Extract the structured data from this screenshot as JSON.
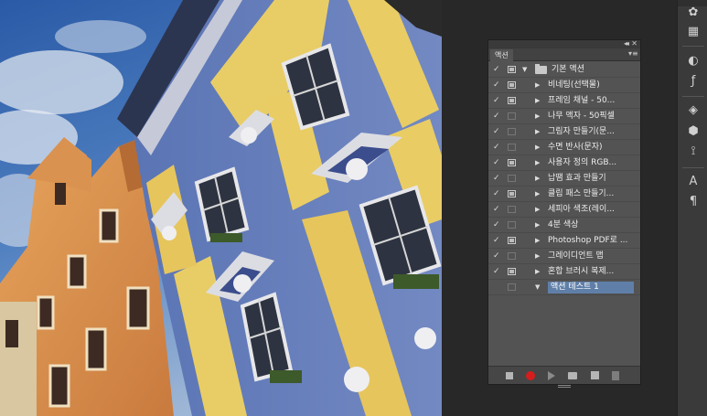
{
  "panel": {
    "tab_label": "액션",
    "collapse_glyph": "◂◂",
    "close_glyph": "✕",
    "menu_glyph": "▾≡",
    "rows": [
      {
        "label": "기본 액션",
        "checked": true,
        "dialog": "filled",
        "type": "set",
        "expanded": true
      },
      {
        "label": "비네팅(선택물)",
        "checked": true,
        "dialog": "filled",
        "type": "action"
      },
      {
        "label": "프레임 채널 - 50...",
        "checked": true,
        "dialog": "filled",
        "type": "action"
      },
      {
        "label": "나무 액자 - 50픽셀",
        "checked": true,
        "dialog": "empty",
        "type": "action"
      },
      {
        "label": "그림자 만들기(문...",
        "checked": true,
        "dialog": "empty",
        "type": "action"
      },
      {
        "label": "수면 반사(문자)",
        "checked": true,
        "dialog": "empty",
        "type": "action"
      },
      {
        "label": "사용자 정의 RGB...",
        "checked": true,
        "dialog": "filled",
        "type": "action"
      },
      {
        "label": "납땜 효과 만들기",
        "checked": true,
        "dialog": "empty",
        "type": "action"
      },
      {
        "label": "클립 패스 만들기...",
        "checked": true,
        "dialog": "filled",
        "type": "action"
      },
      {
        "label": "세피아 색조(레이...",
        "checked": true,
        "dialog": "empty",
        "type": "action"
      },
      {
        "label": "4분 색상",
        "checked": true,
        "dialog": "empty",
        "type": "action"
      },
      {
        "label": "Photoshop PDF로 ...",
        "checked": true,
        "dialog": "filled",
        "type": "action"
      },
      {
        "label": "그레이디언트 맵",
        "checked": true,
        "dialog": "empty",
        "type": "action"
      },
      {
        "label": "혼합 브러시 복제...",
        "checked": true,
        "dialog": "filled",
        "type": "action"
      },
      {
        "label": "액션 테스트 1",
        "checked": false,
        "dialog": "empty",
        "type": "set",
        "expanded": true,
        "selected": true
      }
    ]
  },
  "bottom_bar": [
    "stop-icon",
    "record-icon",
    "play-icon",
    "new-set-icon",
    "new-action-icon",
    "trash-icon"
  ],
  "dock_icons": [
    "palette-icon",
    "swatches-icon",
    "adjustments-icon",
    "styles-icon",
    "layers-icon",
    "channels-icon",
    "paths-icon",
    "character-icon",
    "paragraph-icon"
  ],
  "colors": {
    "selected_row": "#5f7fa8",
    "record": "#d51d1d",
    "panel_bg": "#535353"
  }
}
